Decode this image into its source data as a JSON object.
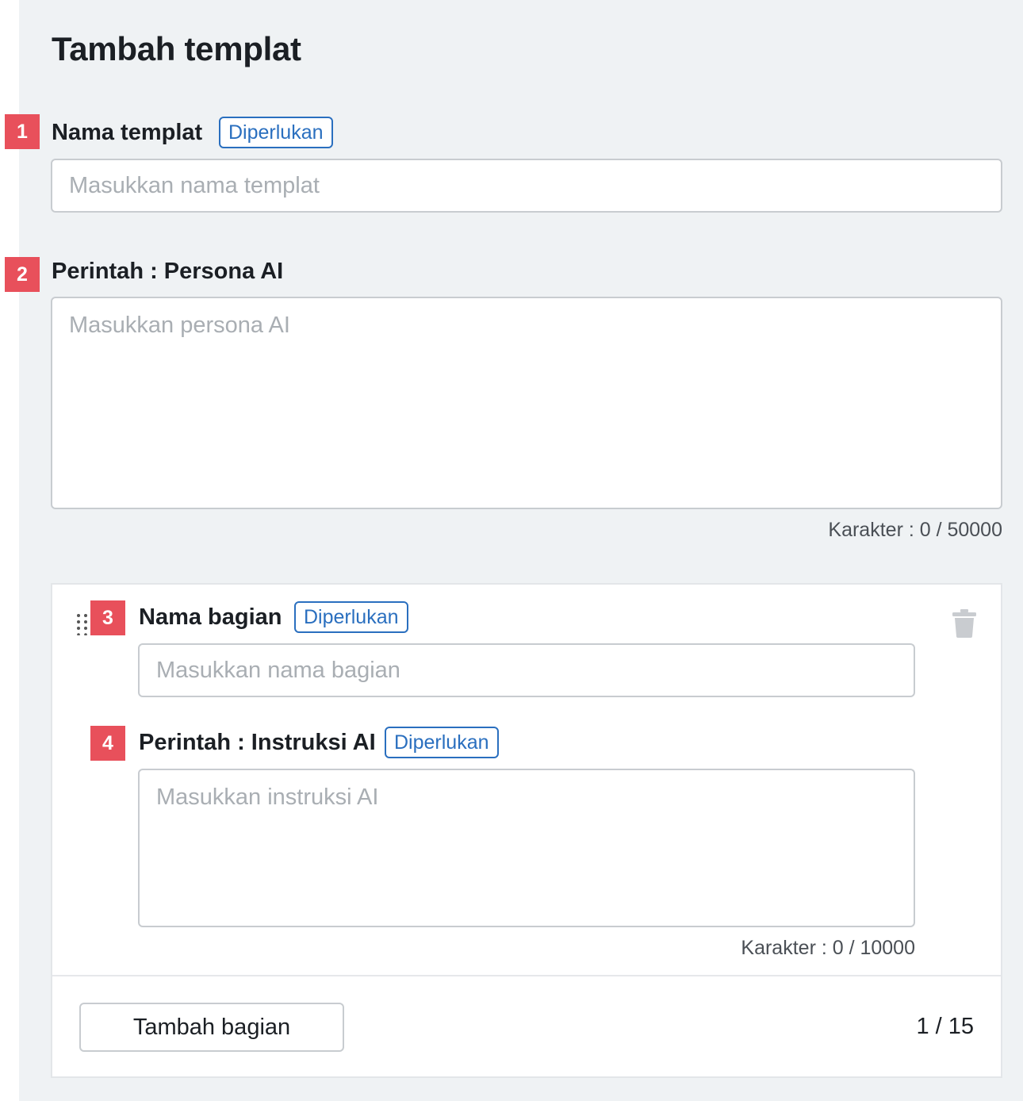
{
  "page": {
    "title": "Tambah templat"
  },
  "fields": {
    "template_name": {
      "step": "1",
      "label": "Nama templat",
      "required_label": "Diperlukan",
      "placeholder": "Masukkan nama templat",
      "value": ""
    },
    "persona": {
      "step": "2",
      "label": "Perintah : Persona AI",
      "placeholder": "Masukkan persona AI",
      "value": "",
      "counter": "Karakter : 0 / 50000"
    }
  },
  "section": {
    "name": {
      "step": "3",
      "label": "Nama bagian",
      "required_label": "Diperlukan",
      "placeholder": "Masukkan nama bagian",
      "value": ""
    },
    "instruction": {
      "step": "4",
      "label": "Perintah : Instruksi AI",
      "required_label": "Diperlukan",
      "placeholder": "Masukkan instruksi AI",
      "value": "",
      "counter": "Karakter : 0 / 10000"
    },
    "drag_icon": "drag-handle-icon",
    "delete_icon": "trash-icon"
  },
  "footer": {
    "add_button_label": "Tambah bagian",
    "page_count": "1 / 15"
  },
  "colors": {
    "accent": "#2a6fbf",
    "step_badge": "#e8505b",
    "panel_bg": "#eff2f4"
  }
}
